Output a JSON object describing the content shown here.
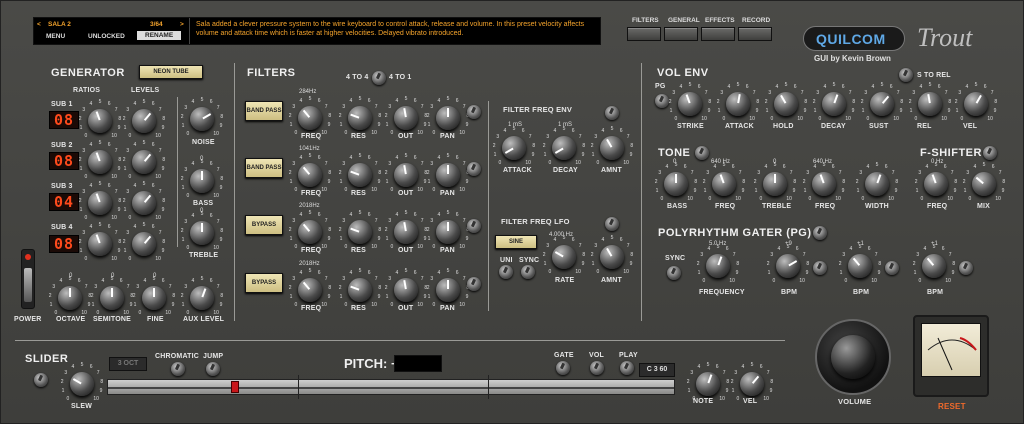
{
  "header": {
    "preset_name": "SALA 2",
    "preset_index": "3/64",
    "menu_label": "MENU",
    "unlocked_label": "UNLOCKED",
    "rename_label": "RENAME",
    "description": "Sala added a clever pressure system to the wire keyboard to control attack, release and volume. In this preset velocity affects volume and attack time which is faster at higher velocities. Delayed vibrato introduced.",
    "nav": [
      "FILTERS",
      "GENERAL",
      "EFFECTS",
      "RECORD"
    ],
    "brand": "QUILCOM",
    "product": "Trout",
    "credit": "GUI by Kevin Brown"
  },
  "generator": {
    "title": "GENERATOR",
    "neon_label": "NEON TUBE",
    "ratios_label": "RATIOS",
    "levels_label": "LEVELS",
    "subs": [
      {
        "label": "SUB 1",
        "value": "08"
      },
      {
        "label": "SUB 2",
        "value": "08"
      },
      {
        "label": "SUB 3",
        "value": "04"
      },
      {
        "label": "SUB 4",
        "value": "08"
      }
    ],
    "noise_label": "NOISE",
    "bass_value": "0",
    "bass_label": "BASS",
    "treble_value": "0",
    "treble_label": "TREBLE",
    "octave_value": "0",
    "octave_label": "OCTAVE",
    "semitone_value": "0",
    "semitone_label": "SEMITONE",
    "fine_value": "0",
    "fine_label": "FINE",
    "aux_label": "AUX LEVEL",
    "power_label": "POWER"
  },
  "filters": {
    "title": "FILTERS",
    "route_a": "4 TO 4",
    "route_b": "4 TO 1",
    "rows": [
      {
        "mode": "BAND PASS",
        "freq": "284Hz"
      },
      {
        "mode": "BAND PASS",
        "freq": "1041Hz"
      },
      {
        "mode": "BYPASS",
        "freq": "2018Hz"
      },
      {
        "mode": "BYPASS",
        "freq": "2018Hz"
      }
    ],
    "freq_label": "FREQ",
    "res_label": "RES",
    "out_label": "OUT",
    "pan_label": "PAN",
    "env_title": "FILTER FREQ  ENV",
    "env_attack_value": "1 mS",
    "env_decay_value": "1 mS",
    "attack_label": "ATTACK",
    "decay_label": "DECAY",
    "amnt_label": "AMNT",
    "lfo_title": "FILTER FREQ  LFO",
    "lfo_wave": "SINE",
    "lfo_rate_value": "4.000 Hz",
    "uni_label": "UNI",
    "sync_label": "SYNC",
    "rate_label": "RATE"
  },
  "vol_env": {
    "title": "VOL ENV",
    "pg_label": "PG",
    "s_to_rel": "S TO REL",
    "knobs": [
      "STRIKE",
      "ATTACK",
      "HOLD",
      "DECAY",
      "SUST",
      "REL",
      "VEL"
    ]
  },
  "tone": {
    "title": "TONE",
    "bass_value": "0",
    "bass_label": "BASS",
    "freq1_value": "640 Hz",
    "freq_label": "FREQ",
    "treble_value": "0",
    "treble_label": "TREBLE",
    "freq2_value": "640 Hz",
    "width_label": "WIDTH"
  },
  "fshifter": {
    "title": "F-SHIFTER",
    "freq_value": "0 Hz",
    "freq_label": "FREQ",
    "mix_label": "MIX"
  },
  "poly": {
    "title": "POLYRHYTHM  GATER (PG)",
    "sync_label": "SYNC",
    "freq_value": "5.0 Hz",
    "frequency_label": "FREQUENCY",
    "bpm_values": [
      "+9",
      "+1",
      "+1"
    ],
    "bpm_label": "BPM"
  },
  "bottom": {
    "slider_title": "SLIDER",
    "oct_display": "3 OCT",
    "chromatic_label": "CHROMATIC",
    "jump_label": "JUMP",
    "slew_label": "SLEW",
    "pitch_label": "PITCH: +",
    "gate_label": "GATE",
    "vol_label": "VOL",
    "play_label": "PLAY",
    "note_display": "C 3  60",
    "note_label": "NOTE",
    "vel_label": "VEL",
    "volume_label": "VOLUME",
    "reset_label": "RESET",
    "pitch_slider_value": 0.22
  }
}
